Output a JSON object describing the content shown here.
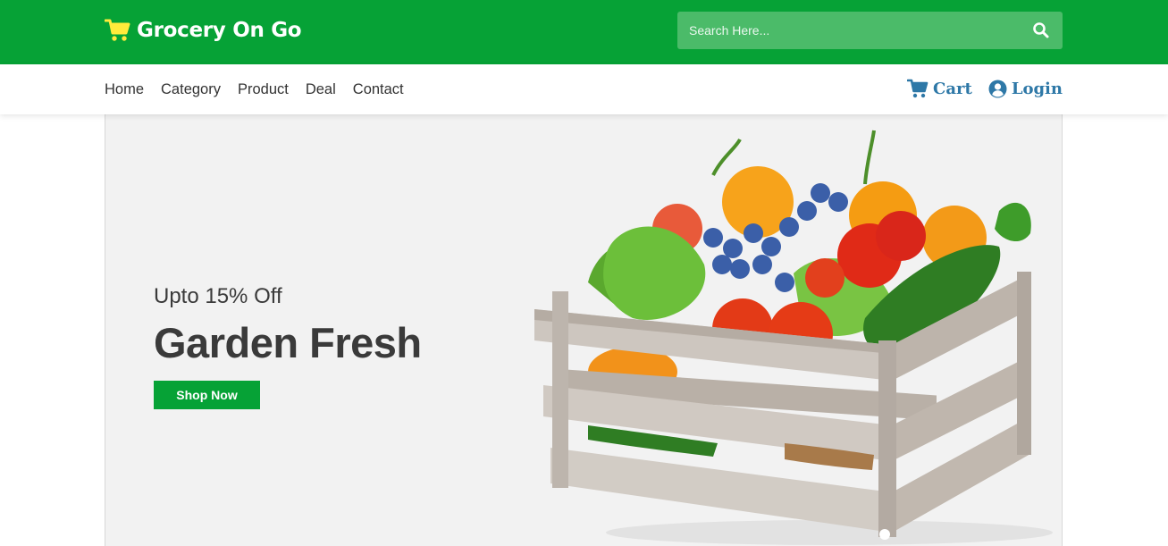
{
  "header": {
    "brand_name": "Grocery On Go",
    "brand_icon": "cart-icon",
    "search_placeholder": "Search Here...",
    "search_icon": "search-icon",
    "colors": {
      "primary": "#06a236",
      "search_bg": "#4bbb69",
      "accent": "#2e78a7",
      "cart_icon": "#ffeb3b"
    }
  },
  "nav": {
    "links": [
      "Home",
      "Category",
      "Product",
      "Deal",
      "Contact"
    ],
    "cart_label": "Cart",
    "login_label": "Login",
    "cart_icon": "cart-icon",
    "login_icon": "user-circle-icon"
  },
  "hero": {
    "subtitle": "Upto 15% Off",
    "title": "Garden Fresh",
    "button_label": "Shop Now",
    "image": "vegetable-crate-image"
  }
}
